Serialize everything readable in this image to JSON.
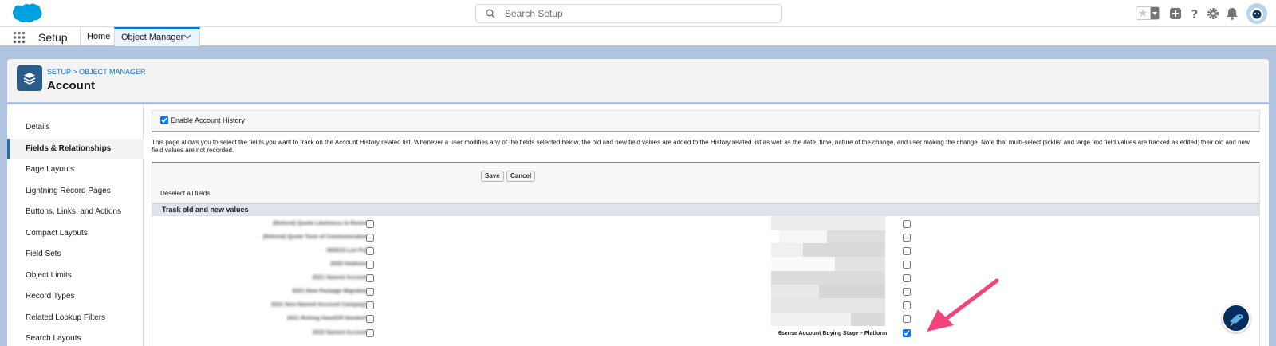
{
  "header": {
    "search_placeholder": "Search Setup",
    "icons": [
      "salesforce-cloud-icon",
      "favorites-star-icon",
      "add-icon",
      "help-icon",
      "setup-gear-icon",
      "notification-bell-icon",
      "user-avatar"
    ]
  },
  "context": {
    "app_name": "Setup",
    "tabs": [
      {
        "label": "Home"
      },
      {
        "label": "Object Manager"
      }
    ]
  },
  "page": {
    "breadcrumb": "SETUP > OBJECT MANAGER",
    "title": "Account"
  },
  "sidebar": {
    "items": [
      {
        "label": "Details"
      },
      {
        "label": "Fields & Relationships"
      },
      {
        "label": "Page Layouts"
      },
      {
        "label": "Lightning Record Pages"
      },
      {
        "label": "Buttons, Links, and Actions"
      },
      {
        "label": "Compact Layouts"
      },
      {
        "label": "Field Sets"
      },
      {
        "label": "Object Limits"
      },
      {
        "label": "Record Types"
      },
      {
        "label": "Related Lookup Filters"
      },
      {
        "label": "Search Layouts"
      }
    ]
  },
  "main": {
    "enable_history_label": "Enable Account History",
    "description": "This page allows you to select the fields you want to track on the Account History related list. Whenever a user modifies any of the fields selected below, the old and new field values are added to the History related list as well as the date, time, nature of the change, and user making the change. Note that multi-select picklist and large text field values are tracked as edited; their old and new field values are not recorded.",
    "save_label": "Save",
    "cancel_label": "Cancel",
    "deselect_label": "Deselect all fields",
    "section_title": "Track old and new values",
    "left_fields": [
      {
        "label": "(Retired) Quote Likeliness to Renew",
        "checked": false
      },
      {
        "label": "(Retired) Quote Tone of Communication",
        "checked": false
      },
      {
        "label": "060619 List Pull",
        "checked": false
      },
      {
        "label": "2020 Holdover",
        "checked": false
      },
      {
        "label": "2021 Named Account",
        "checked": false
      },
      {
        "label": "2021 New Package Migration",
        "checked": false
      },
      {
        "label": "2021 Non-Named Account Campaign",
        "checked": false
      },
      {
        "label": "2021 Rolling HandOff Needed?",
        "checked": false
      },
      {
        "label": "2022 Named Account",
        "checked": false
      }
    ],
    "right_fields": [
      {
        "label": "",
        "checked": false
      },
      {
        "label": "",
        "checked": false
      },
      {
        "label": "",
        "checked": false
      },
      {
        "label": "",
        "checked": false
      },
      {
        "label": "",
        "checked": false
      },
      {
        "label": "",
        "checked": false
      },
      {
        "label": "",
        "checked": false
      },
      {
        "label": "",
        "checked": false
      },
      {
        "label": "6sense Account Buying Stage – Platform",
        "checked": true
      }
    ]
  },
  "colors": {
    "brand": "#0176d3",
    "background": "#b0c4df",
    "arrow": "#f0447a",
    "object_icon": "#2b5c8a"
  }
}
